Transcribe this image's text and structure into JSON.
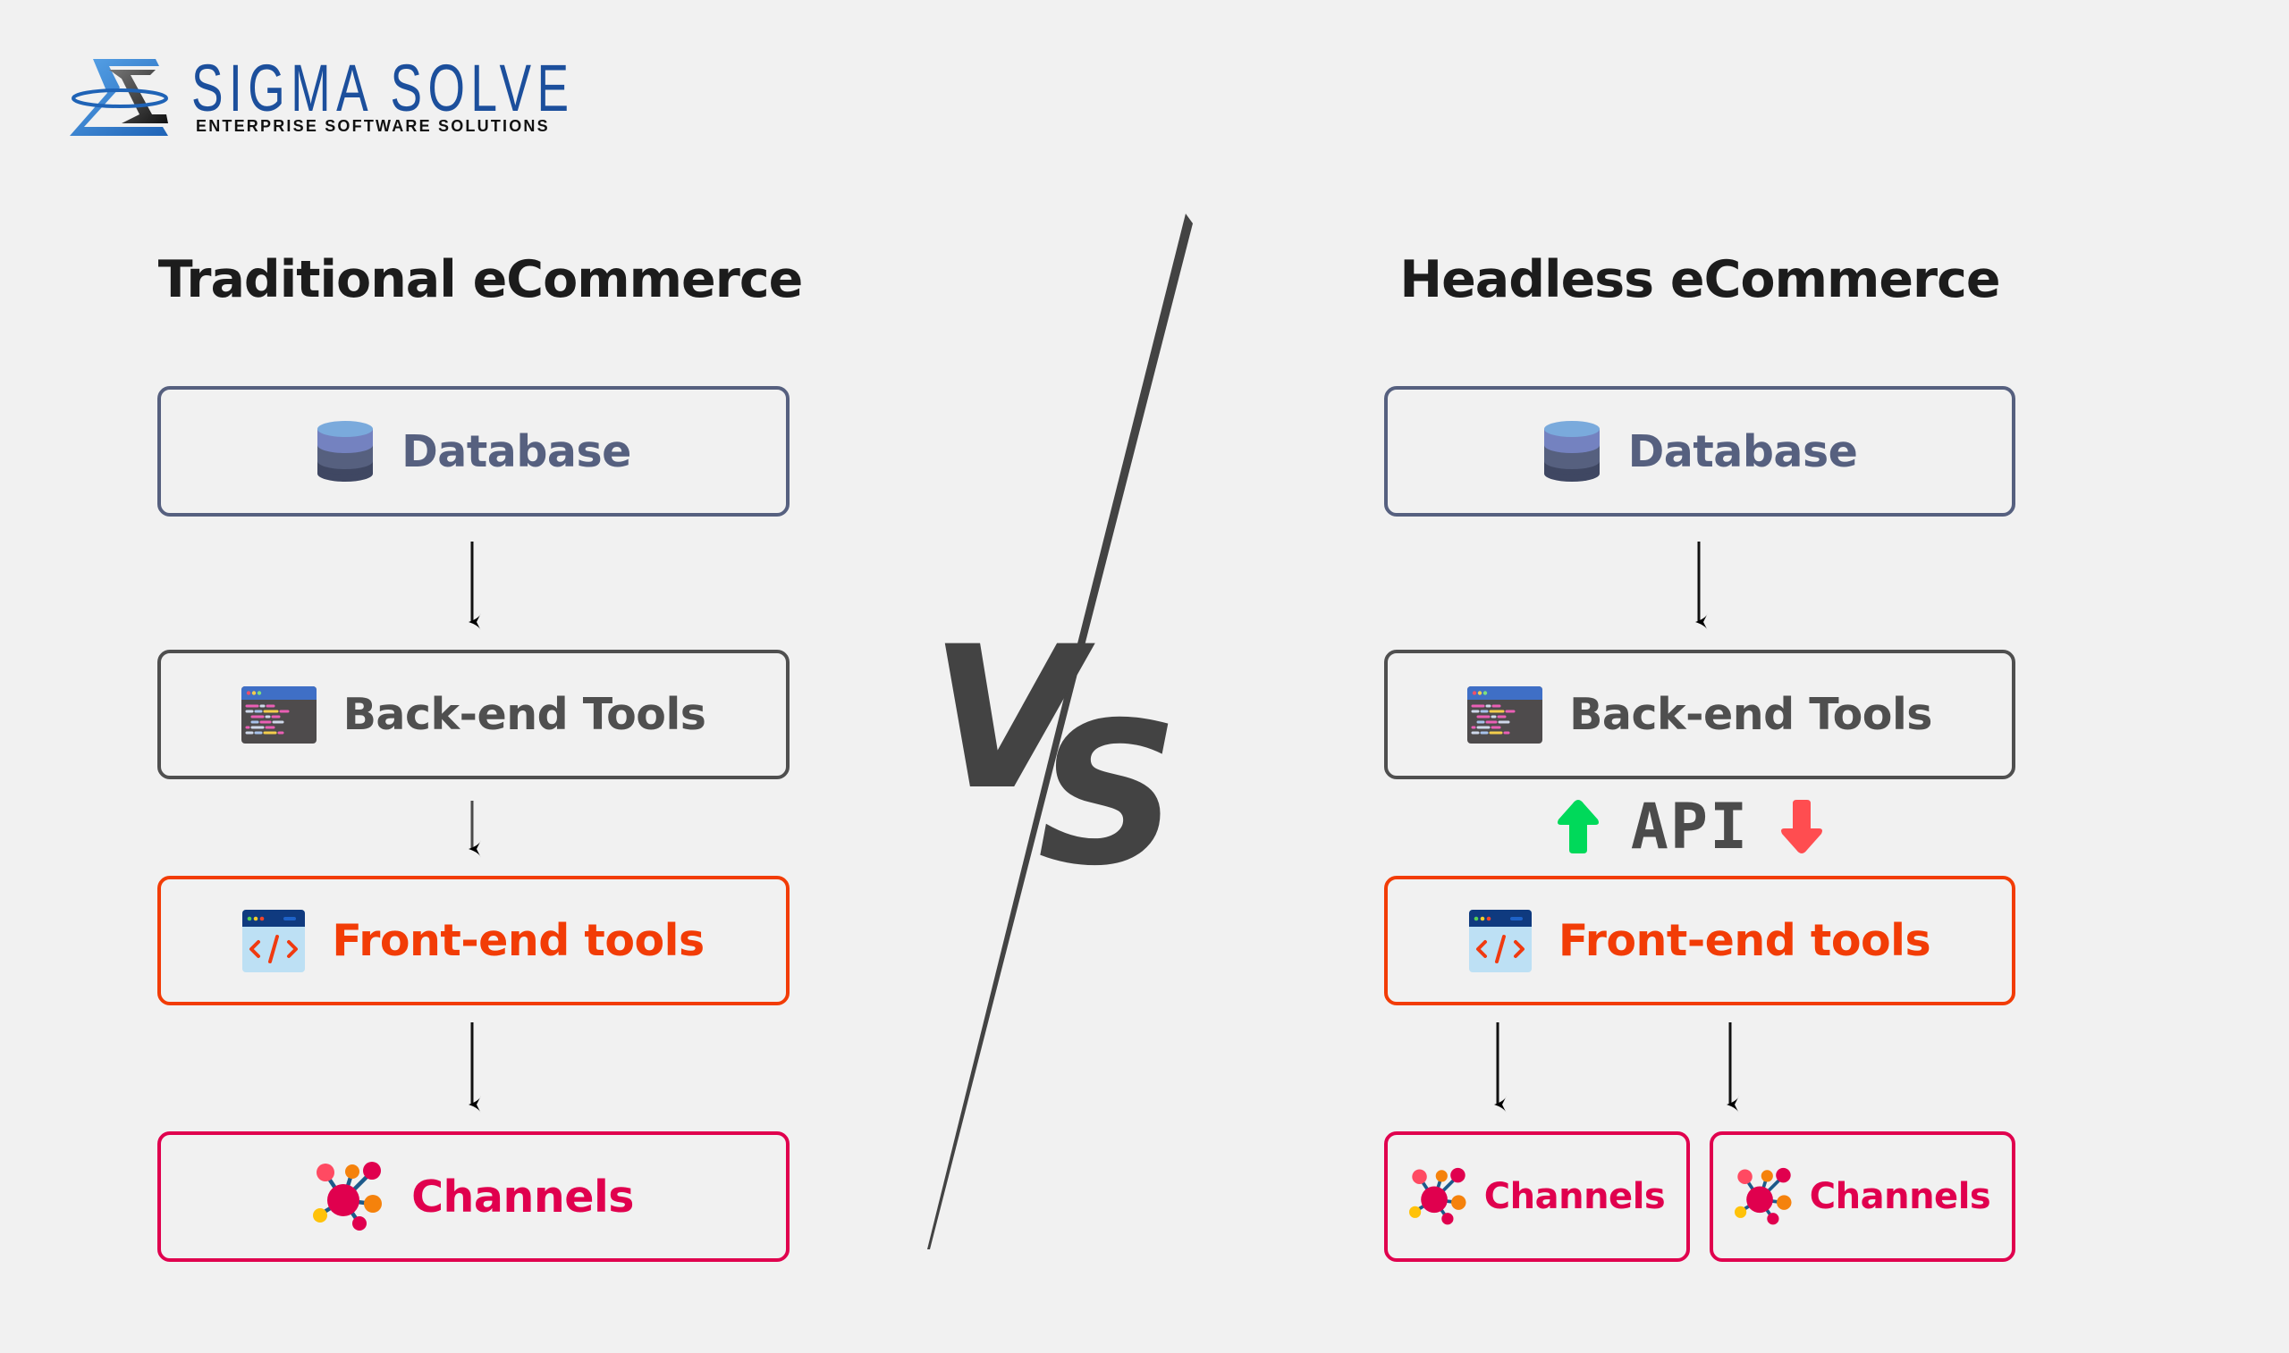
{
  "logo": {
    "name": "SIGMA SOLVE",
    "tagline": "ENTERPRISE SOFTWARE SOLUTIONS",
    "icon": "sigma-logo-icon",
    "color": "#1c4f9c"
  },
  "separator": {
    "label": "VS",
    "color": "#434343"
  },
  "colors": {
    "database": "#56607f",
    "backend": "#4f4f4f",
    "frontend": "#f23c06",
    "channels": "#e0004e",
    "api_up": "#00d95a",
    "api_down": "#ff4d50",
    "background": "#f1f1f1"
  },
  "traditional": {
    "title": "Traditional eCommerce",
    "nodes": [
      {
        "label": "Database",
        "icon": "database-icon"
      },
      {
        "label": "Back-end Tools",
        "icon": "code-window-icon"
      },
      {
        "label": "Front-end tools",
        "icon": "html-code-icon"
      },
      {
        "label": "Channels",
        "icon": "network-nodes-icon"
      }
    ]
  },
  "headless": {
    "title": "Headless eCommerce",
    "nodes": [
      {
        "label": "Database",
        "icon": "database-icon"
      },
      {
        "label": "Back-end Tools",
        "icon": "code-window-icon"
      },
      {
        "label": "Front-end tools",
        "icon": "html-code-icon"
      }
    ],
    "api_label": "API",
    "channels": [
      {
        "label": "Channels",
        "icon": "network-nodes-icon"
      },
      {
        "label": "Channels",
        "icon": "network-nodes-icon"
      }
    ]
  }
}
